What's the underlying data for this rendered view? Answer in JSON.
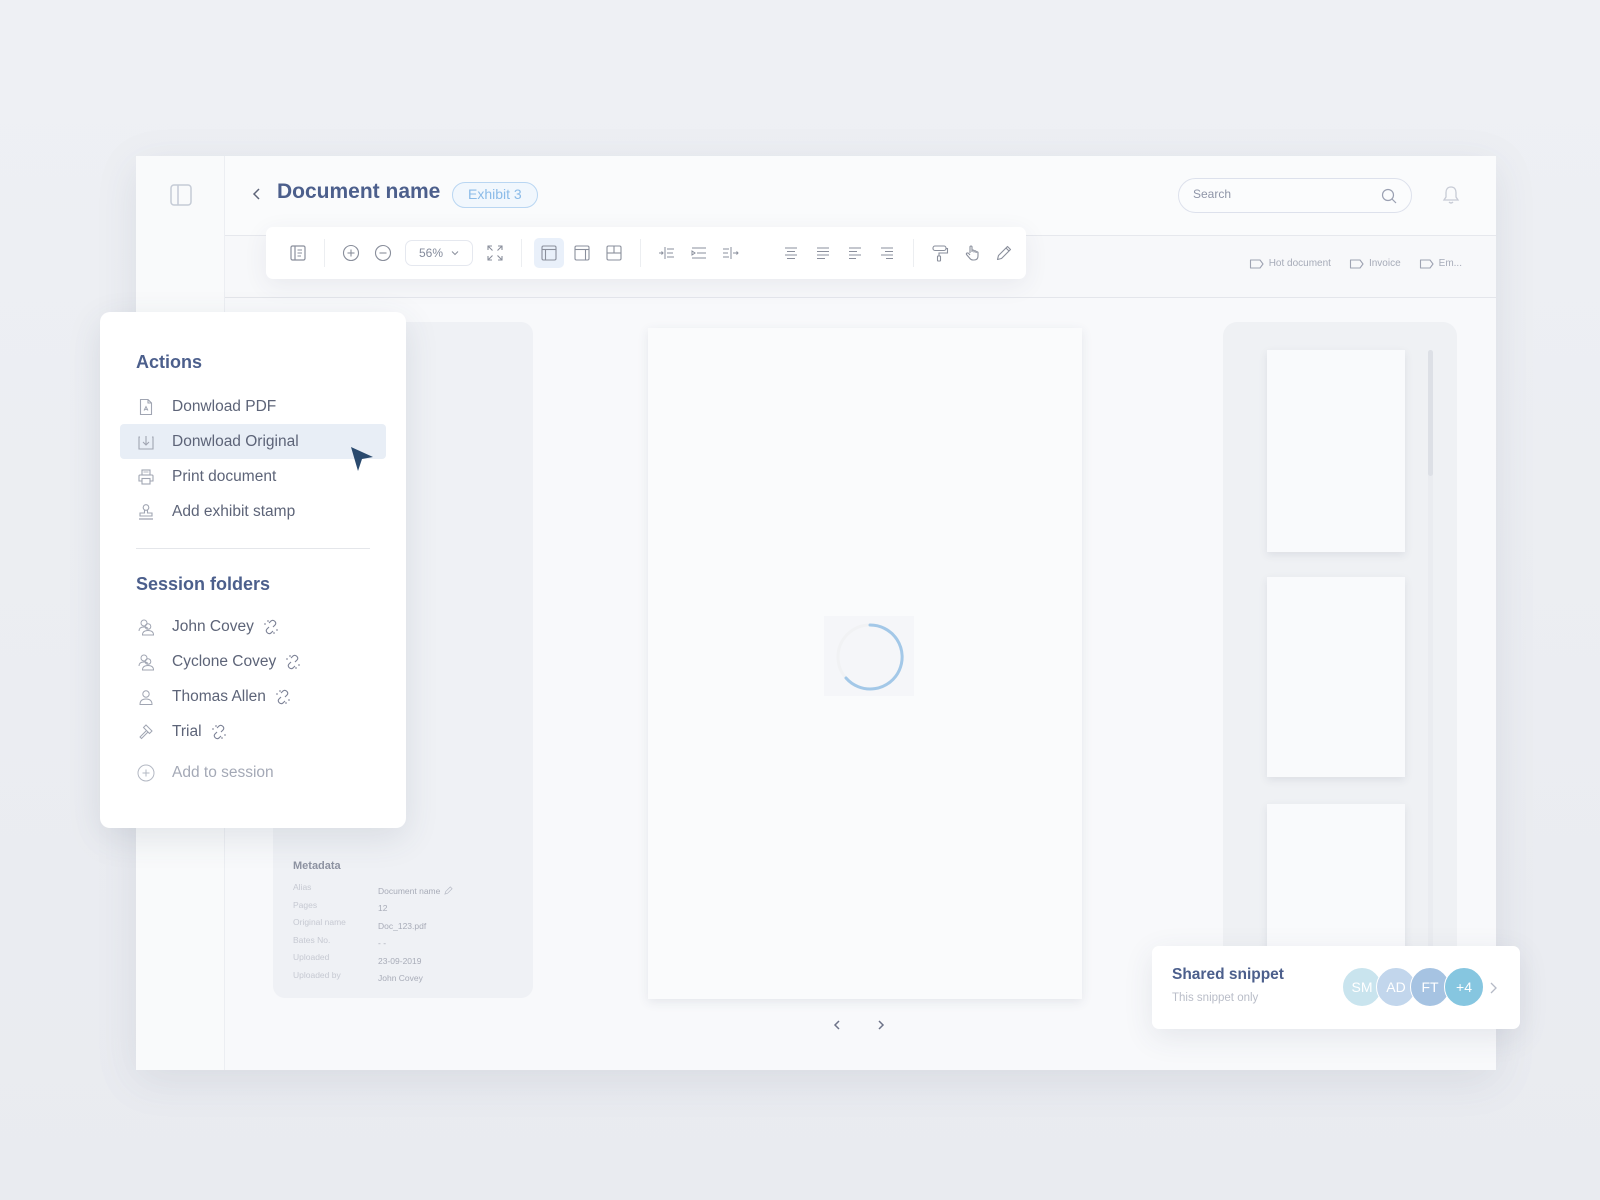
{
  "header": {
    "title": "Document name",
    "badge": "Exhibit 3",
    "search_placeholder": "Search"
  },
  "toolbar": {
    "zoom_level": "56%",
    "buttons": [
      "toggle-outline",
      "zoom-in",
      "zoom-out",
      "fit-screen",
      "layout-single",
      "layout-side",
      "layout-split",
      "indent-in",
      "indent-play",
      "indent-out",
      "align-center",
      "align-justify",
      "align-left",
      "align-right",
      "paint-roller",
      "hand-tool",
      "pencil"
    ],
    "active_layout": "layout-single"
  },
  "tags": [
    {
      "label": "Hot document"
    },
    {
      "label": "Invoice"
    },
    {
      "label": "Em..."
    }
  ],
  "actions": {
    "title": "Actions",
    "items": [
      {
        "label": "Donwload PDF",
        "icon": "file-pdf-icon"
      },
      {
        "label": "Donwload Original",
        "icon": "download-icon",
        "hovered": true
      },
      {
        "label": "Print document",
        "icon": "printer-icon"
      },
      {
        "label": "Add exhibit stamp",
        "icon": "stamp-icon"
      }
    ]
  },
  "session_folders": {
    "title": "Session folders",
    "items": [
      {
        "label": "John Covey",
        "icon": "users-icon",
        "linked": true
      },
      {
        "label": "Cyclone Covey",
        "icon": "users-icon",
        "linked": true
      },
      {
        "label": "Thomas Allen",
        "icon": "user-icon",
        "linked": true
      },
      {
        "label": "Trial",
        "icon": "gavel-icon",
        "linked": true
      }
    ],
    "add_label": "Add to session"
  },
  "metadata": {
    "title": "Metadata",
    "rows": [
      {
        "key": "Alias",
        "value": "Document name",
        "editable": true
      },
      {
        "key": "Pages",
        "value": "12"
      },
      {
        "key": "Original name",
        "value": "Doc_123.pdf"
      },
      {
        "key": "Bates No.",
        "value": "- -"
      },
      {
        "key": "Uploaded",
        "value": "23-09-2019"
      },
      {
        "key": "Uploaded by",
        "value": "John Covey"
      }
    ]
  },
  "viewer": {
    "loading": true,
    "prev_label": "‹",
    "next_label": "›"
  },
  "snippet": {
    "title": "Shared snippet",
    "subtitle": "This snippet only",
    "avatars": [
      {
        "initials": "SM",
        "color": "#c9e4ee"
      },
      {
        "initials": "AD",
        "color": "#c2d6ec"
      },
      {
        "initials": "FT",
        "color": "#a6c3e2"
      },
      {
        "initials": "+4",
        "color": "#86c6e0"
      }
    ]
  },
  "colors": {
    "accent": "#4c5f8c",
    "badge": "#8bbbe8",
    "spinner": "#a3c8e8",
    "cursor": "#2a4a6e"
  }
}
